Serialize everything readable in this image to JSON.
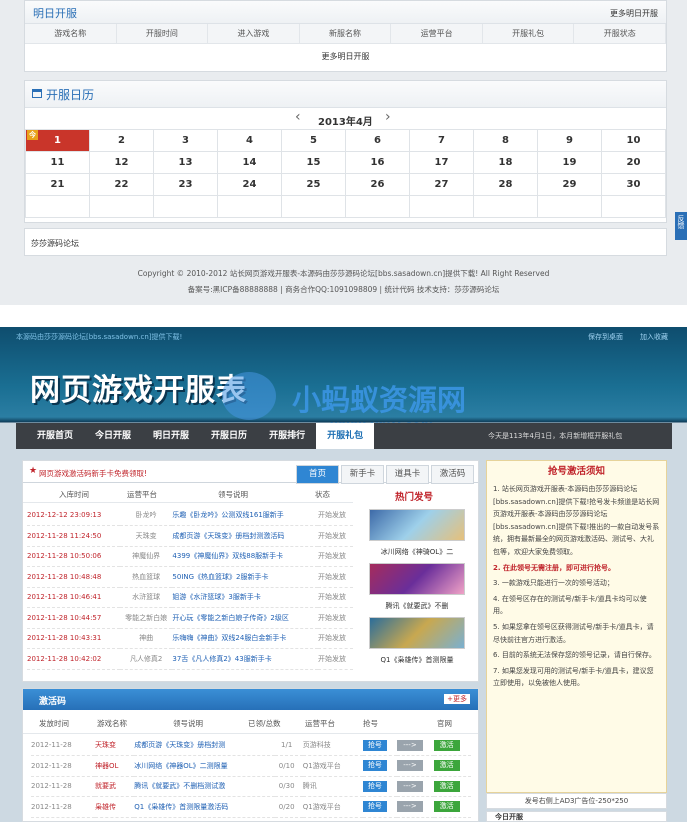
{
  "top": {
    "tomorrow": {
      "title": "明日开服",
      "more": "更多明日开服",
      "headers": [
        "游戏名称",
        "开服时间",
        "进入游戏",
        "新服名称",
        "运营平台",
        "开服礼包",
        "开服状态"
      ],
      "more_link": "更多明日开服"
    },
    "calendar": {
      "title": "开服日历",
      "month": "2013年4月",
      "prev": "‹",
      "next": "›",
      "today_tag": "今",
      "rows": [
        [
          "1",
          "2",
          "3",
          "4",
          "5",
          "6",
          "7",
          "8",
          "9",
          "10"
        ],
        [
          "11",
          "12",
          "13",
          "14",
          "15",
          "16",
          "17",
          "18",
          "19",
          "20"
        ],
        [
          "21",
          "22",
          "23",
          "24",
          "25",
          "26",
          "27",
          "28",
          "29",
          "30"
        ],
        [
          "",
          "",
          "",
          "",
          "",
          "",
          "",
          "",
          "",
          ""
        ]
      ]
    },
    "links_label": "莎莎源码论坛",
    "footer1": "Copyright © 2010-2012  站长网页游戏开服表-本源码由莎莎源码论坛[bbs.sasadown.cn]提供下载!   All Right Reserved",
    "footer2": "备案号:黑ICP备88888888 | 商务合作QQ:1091098809 | 统计代码 技术支持：莎莎源码论坛",
    "side_tab": "反馈"
  },
  "site": {
    "topleft": "本源码由莎莎源码论坛[bbs.sasadown.cn]提供下载!",
    "save_desktop": "保存到桌面",
    "add_fav": "加入收藏",
    "logo": "网页游戏开服表",
    "watermark": "小蚂蚁资源网",
    "watermark2": "www.xmy.com",
    "nav": [
      "开服首页",
      "今日开服",
      "明日开服",
      "开服日历",
      "开服排行",
      "开服礼包"
    ],
    "nav_active": 5,
    "nav_notice": "今天是113年4月1日，本月新增框开服礼包",
    "gift": {
      "notice": "网页游戏激活码新手卡免费领取!",
      "tabs": [
        "首页",
        "新手卡",
        "道具卡",
        "激活码"
      ],
      "headers": [
        "入库时间",
        "运营平台",
        "领号说明",
        "状态"
      ],
      "hot": "热门发号",
      "rows": [
        [
          "2012-12-12 23:09:13",
          "卧龙吟",
          "乐趣《卧龙吟》公测双线161服新手",
          "开始发放"
        ],
        [
          "2012-11-28 11:24:50",
          "天珠变",
          "成都页游《天珠变》册档封测激活码",
          "开始发放"
        ],
        [
          "2012-11-28 10:50:06",
          "神魔仙界",
          "4399《神魔仙界》双线88服新手卡",
          "开始发放"
        ],
        [
          "2012-11-28 10:48:48",
          "热血篮球",
          "50ING《热血篮球》2服新手卡",
          "开始发放"
        ],
        [
          "2012-11-28 10:46:41",
          "水浒篮球",
          "姐游《水浒篮球》3服新手卡",
          "开始发放"
        ],
        [
          "2012-11-28 10:44:57",
          "零能之新白娘",
          "开心玩《零能之新白娘子传奇》2级区",
          "开始发放"
        ],
        [
          "2012-11-28 10:43:31",
          "神曲",
          "乐嗨嗨《神曲》双线24服白金新手卡",
          "开始发放"
        ],
        [
          "2012-11-28 10:42:02",
          "凡人修真2",
          "37舌《凡人修真2》43服新手卡",
          "开始发放"
        ]
      ],
      "hot_items": [
        "冰川网络《神骑OL》二",
        "腾讯《就要武》不删",
        "Q1《枭雄传》首测限量"
      ]
    },
    "activation": {
      "title": "激活码",
      "more": "+更多",
      "headers": [
        "发放时间",
        "游戏名称",
        "领号说明",
        "已领/总数",
        "运营平台",
        "抢号",
        "官网"
      ],
      "rows": [
        [
          "2012-11-28",
          "天珠变",
          "成都页游《天珠变》册档封测",
          "1/1",
          "页游科技"
        ],
        [
          "2012-11-28",
          "神器OL",
          "冰川网络《神器OL》二测限量",
          "0/10",
          "Q1游戏平台"
        ],
        [
          "2012-11-28",
          "就要武",
          "腾讯《就要武》不删档测试激",
          "0/30",
          "腾讯"
        ],
        [
          "2012-11-28",
          "枭雄传",
          "Q1《枭雄传》首测限量激活码",
          "0/20",
          "Q1游戏平台"
        ]
      ],
      "btn_grab": "抢号",
      "btn_tao": "--->",
      "btn_site": "激活"
    },
    "notice_box": {
      "title": "抢号激活须知",
      "p1": "1. 站长网页游戏开服表-本源码由莎莎源码论坛[bbs.sasadown.cn]提供下载!抢号发卡频道是站长网页游戏开服表-本源码由莎莎源码论坛[bbs.sasadown.cn]提供下载!推出的一款自动发号系统，拥有最新最全的网页游戏激活码、测试号、大礼包等，欢迎大家免费领取。",
      "p2": "2. 在此领号无需注册，即可进行抢号。",
      "p3": "3. 一款游戏只能进行一次的领号活动；",
      "p4": "4. 在领号区存在的测试号/新手卡/道具卡均可以使用。",
      "p5": "5. 如果您拿在领号区获得测试号/新手卡/道具卡，请尽快前往官方进行激活。",
      "p6": "6. 目前的系统无法保存您的领号记录，请自行保存。",
      "p7": "7. 如果您发现可用的测试号/新手卡/道具卡，建议您立即使用，以免被他人使用。",
      "ad": "发号右侧上AD3广告位-250*250",
      "bottom": "今日开服"
    }
  }
}
